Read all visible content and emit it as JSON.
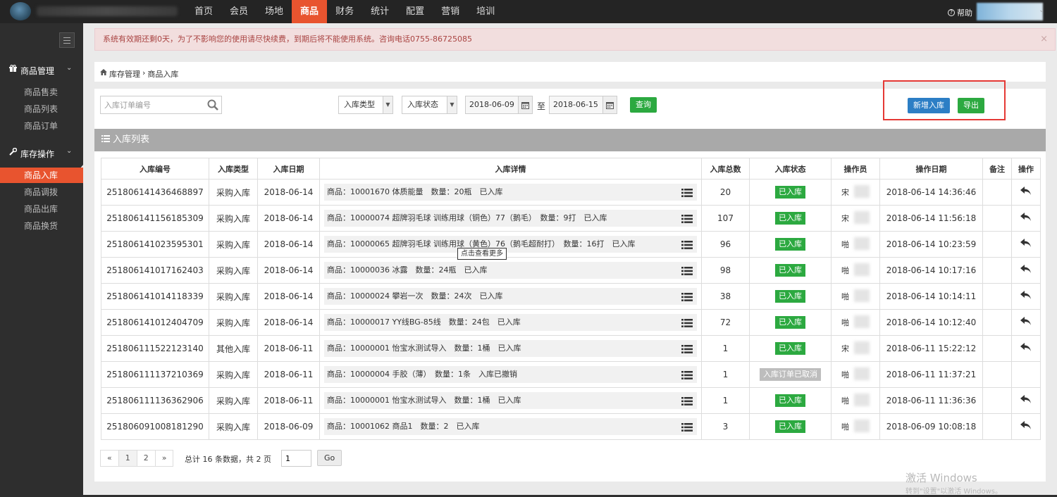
{
  "nav": {
    "items": [
      "首页",
      "会员",
      "场地",
      "商品",
      "财务",
      "统计",
      "配置",
      "营销",
      "培训"
    ],
    "active_index": 3,
    "help_label": "帮助"
  },
  "sidebar": {
    "groups": [
      {
        "label": "商品管理",
        "icon": "gift-icon",
        "items": [
          "商品售卖",
          "商品列表",
          "商品订单"
        ]
      },
      {
        "label": "库存操作",
        "icon": "wrench-icon",
        "items": [
          "商品入库",
          "商品调拨",
          "商品出库",
          "商品换货"
        ]
      }
    ],
    "active_item": "商品入库"
  },
  "alert": {
    "text": "系统有效期还剩0天，为了不影响您的使用请尽快续费，到期后将不能使用系统。咨询电话0755-86725085",
    "close": "×"
  },
  "breadcrumb": {
    "parent": "库存管理",
    "sep": "›",
    "current": "商品入库"
  },
  "filters": {
    "search_placeholder": "入库订单编号",
    "type_select": "入库类型",
    "status_select": "入库状态",
    "date_from": "2018-06-09",
    "date_sep": "至",
    "date_to": "2018-06-15",
    "query_label": "查询"
  },
  "actions": {
    "add_label": "新增入库",
    "export_label": "导出"
  },
  "list": {
    "title": "入库列表",
    "columns": [
      "入库编号",
      "入库类型",
      "入库日期",
      "入库详情",
      "入库总数",
      "入库状态",
      "操作员",
      "操作日期",
      "备注",
      "操作"
    ],
    "rows": [
      {
        "id": "251806141436468897",
        "type": "采购入库",
        "date": "2018-06-14",
        "detail": "商品：10001670 体质能量　数量：20瓶　已入库",
        "total": "20",
        "status": "已入库",
        "cancelled": false,
        "op": "宋",
        "op_date": "2018-06-14 14:36:46",
        "note": "",
        "has_action": true
      },
      {
        "id": "251806141156185309",
        "type": "采购入库",
        "date": "2018-06-14",
        "detail": "商品：10000074 超牌羽毛球 训练用球（铜色）77（鹅毛）　数量：9打　已入库",
        "total": "107",
        "status": "已入库",
        "cancelled": false,
        "op": "宋",
        "op_date": "2018-06-14 11:56:18",
        "note": "",
        "has_action": true
      },
      {
        "id": "251806141023595301",
        "type": "采购入库",
        "date": "2018-06-14",
        "detail": "商品：10000065 超牌羽毛球 训练用球（黄色）76（鹅毛超耐打）　数量：16打　已入库",
        "total": "96",
        "status": "已入库",
        "cancelled": false,
        "op": "啪",
        "op_date": "2018-06-14 10:23:59",
        "note": "",
        "has_action": true
      },
      {
        "id": "251806141017162403",
        "type": "采购入库",
        "date": "2018-06-14",
        "detail": "商品：10000036 冰露　数量：24瓶　已入库",
        "total": "98",
        "status": "已入库",
        "cancelled": false,
        "op": "啪",
        "op_date": "2018-06-14 10:17:16",
        "note": "",
        "has_action": true
      },
      {
        "id": "251806141014118339",
        "type": "采购入库",
        "date": "2018-06-14",
        "detail": "商品：10000024 攀岩一次　数量：24次　已入库",
        "total": "38",
        "status": "已入库",
        "cancelled": false,
        "op": "啪",
        "op_date": "2018-06-14 10:14:11",
        "note": "",
        "has_action": true
      },
      {
        "id": "251806141012404709",
        "type": "采购入库",
        "date": "2018-06-14",
        "detail": "商品：10000017 YY线BG-85线　数量：24包　已入库",
        "total": "72",
        "status": "已入库",
        "cancelled": false,
        "op": "啪",
        "op_date": "2018-06-14 10:12:40",
        "note": "",
        "has_action": true
      },
      {
        "id": "251806111522123140",
        "type": "其他入库",
        "date": "2018-06-11",
        "detail": "商品：10000001 怡宝水测试导入　数量：1桶　已入库",
        "total": "1",
        "status": "已入库",
        "cancelled": false,
        "op": "宋",
        "op_date": "2018-06-11 15:22:12",
        "note": "",
        "has_action": true
      },
      {
        "id": "251806111137210369",
        "type": "采购入库",
        "date": "2018-06-11",
        "detail": "商品：10000004 手胶（薄）　数量：1条　入库已撤销",
        "total": "1",
        "status": "入库订单已取消",
        "cancelled": true,
        "op": "啪",
        "op_date": "2018-06-11 11:37:21",
        "note": "",
        "has_action": false
      },
      {
        "id": "251806111136362906",
        "type": "采购入库",
        "date": "2018-06-11",
        "detail": "商品：10000001 怡宝水测试导入　数量：1桶　已入库",
        "total": "1",
        "status": "已入库",
        "cancelled": false,
        "op": "啪",
        "op_date": "2018-06-11 11:36:36",
        "note": "",
        "has_action": true
      },
      {
        "id": "251806091008181290",
        "type": "采购入库",
        "date": "2018-06-09",
        "detail": "商品：10001062 商品1　数量：2　已入库",
        "total": "3",
        "status": "已入库",
        "cancelled": false,
        "op": "啪",
        "op_date": "2018-06-09 10:08:18",
        "note": "",
        "has_action": true
      }
    ],
    "tooltip": "点击查看更多"
  },
  "pagination": {
    "prev": "«",
    "pages": [
      "1",
      "2"
    ],
    "next": "»",
    "total_text": "总计 16 条数据，共 2 页",
    "input_value": "1",
    "go_label": "Go"
  },
  "watermark": {
    "line1": "激活 Windows",
    "line2": "转到\"设置\"以激活 Windows。"
  },
  "colors": {
    "accent": "#e8542f",
    "success": "#2ca940",
    "primary": "#2c7ec5",
    "alert_text": "#a94442"
  }
}
